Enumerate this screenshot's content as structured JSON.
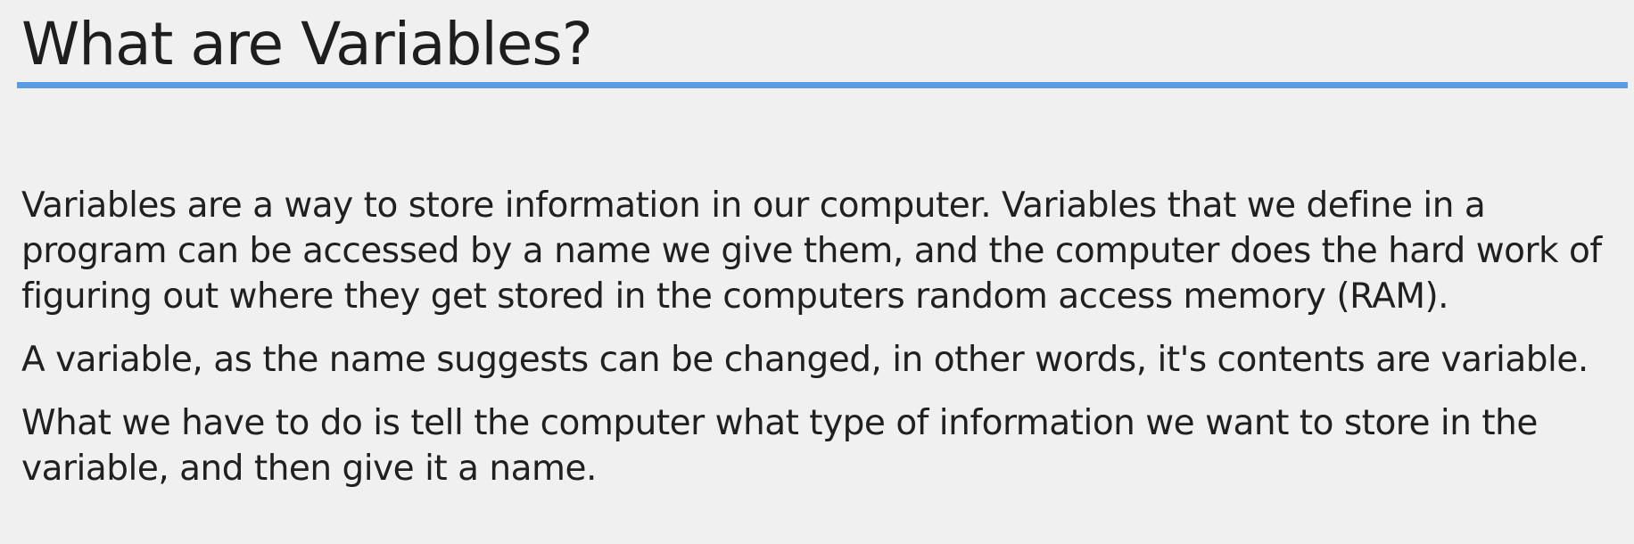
{
  "slide": {
    "title": "What are Variables?",
    "accent_color": "#5b9ae8",
    "paragraphs": [
      "Variables are a way to store information in our computer.  Variables that we define in a program can be accessed by a name we give them, and the computer does the hard work of figuring out where they get stored in the computers random access memory (RAM).",
      "A variable, as the name suggests can be changed, in other words, it's contents are variable.",
      "What we have to do is tell the computer what type of information we want to store in the variable, and then give it a name."
    ]
  }
}
